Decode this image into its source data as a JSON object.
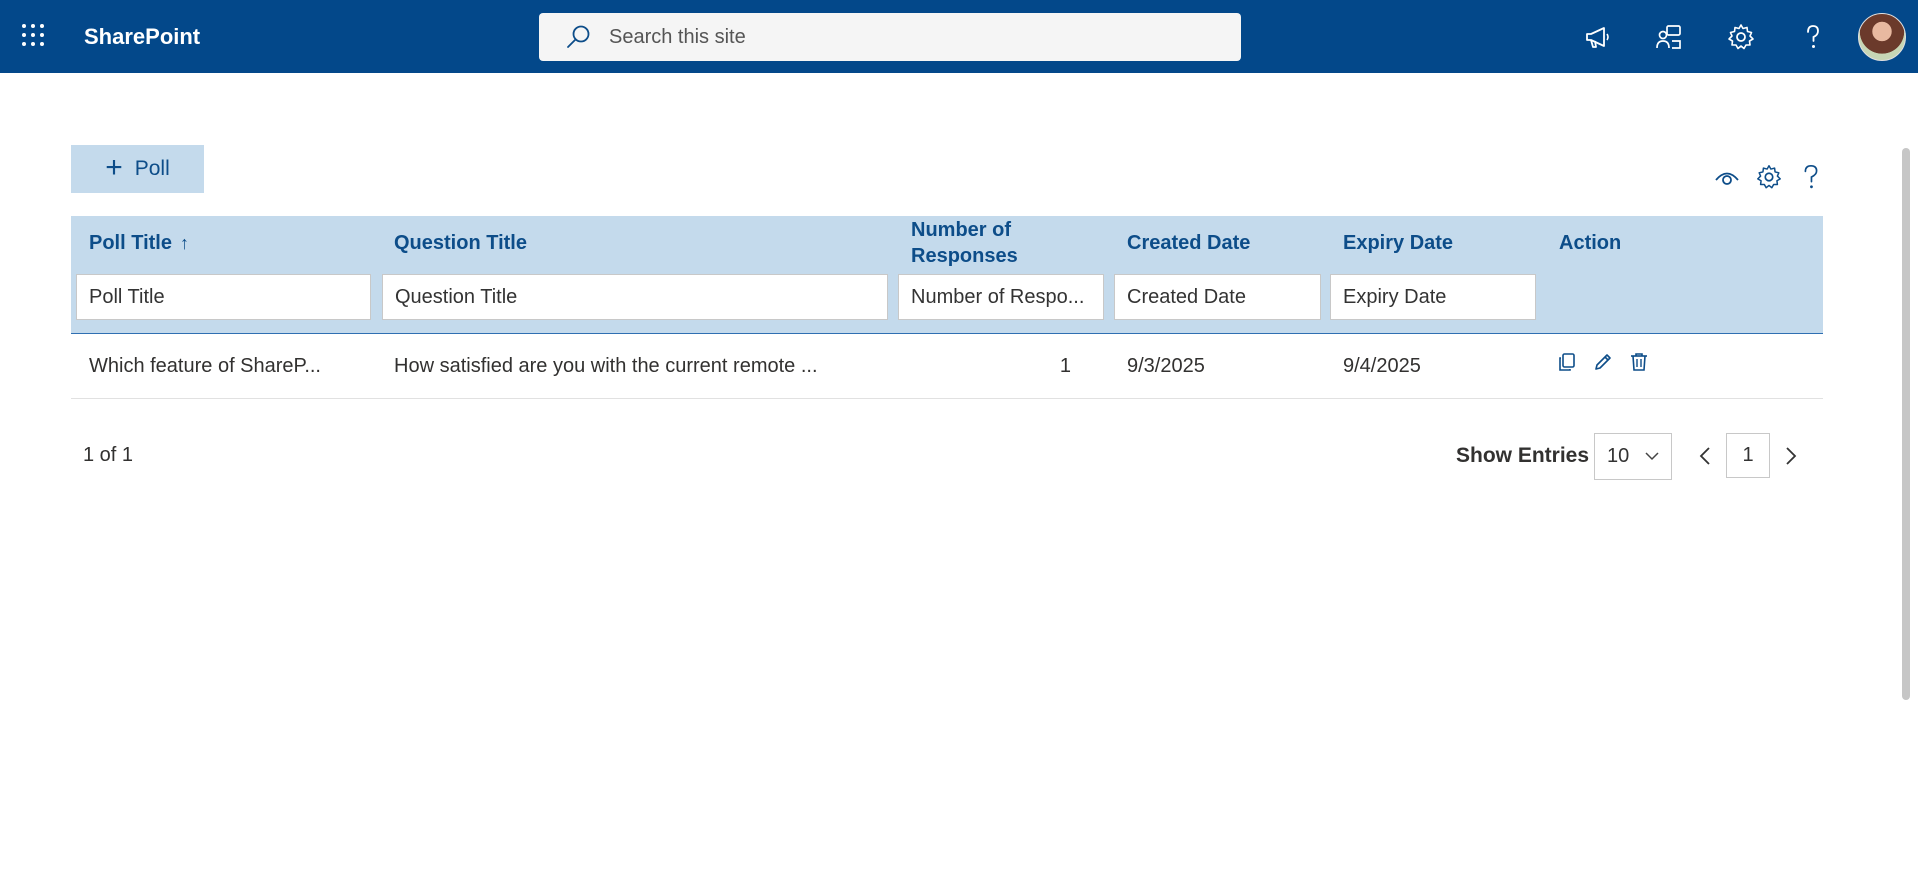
{
  "app": {
    "brand": "SharePoint"
  },
  "search": {
    "placeholder": "Search this site"
  },
  "toolbar": {
    "add_label": "Poll"
  },
  "table": {
    "columns": {
      "poll_title": "Poll Title",
      "question_title": "Question Title",
      "number_of_responses": "Number of Responses",
      "created_date": "Created Date",
      "expiry_date": "Expiry Date",
      "action": "Action"
    },
    "sort_indicator": "↑",
    "filters": {
      "poll_title": "Poll Title",
      "question_title": "Question Title",
      "number_of_responses": "Number of Respo...",
      "created_date": "Created Date",
      "expiry_date": "Expiry Date"
    },
    "rows": [
      {
        "poll_title": "Which feature of ShareP...",
        "question_title": "How satisfied are you with the current remote ...",
        "number_of_responses": "1",
        "created_date": "9/3/2025",
        "expiry_date": "9/4/2025"
      }
    ]
  },
  "pager": {
    "info": "1 of 1",
    "show_entries_label": "Show Entries",
    "entries_value": "10",
    "current_page": "1"
  },
  "colors": {
    "suitebar": "#03488a",
    "header_bg": "#c4daec",
    "accent_text": "#0d4d89"
  },
  "icons": {
    "topbar": [
      "waffle-icon",
      "megaphone-icon",
      "feedback-icon",
      "gear-icon",
      "help-icon",
      "avatar"
    ],
    "tools": [
      "eye-icon",
      "gear-icon",
      "help-icon"
    ],
    "row_actions": [
      "copy-icon",
      "edit-pencil-icon",
      "delete-trash-icon"
    ]
  }
}
